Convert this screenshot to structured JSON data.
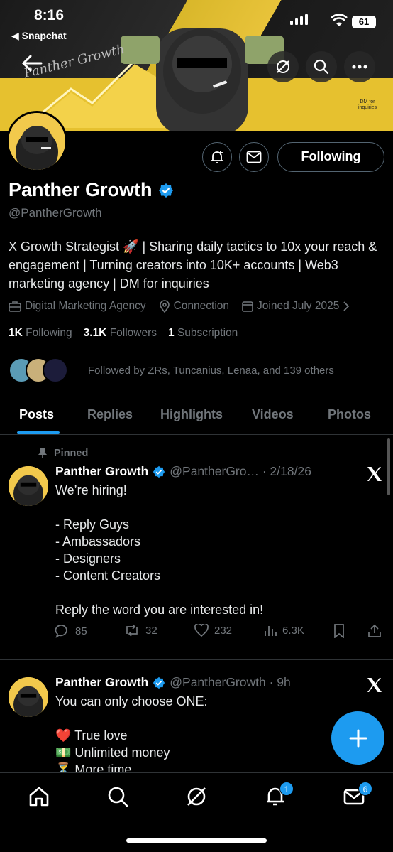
{
  "status_bar": {
    "time": "8:16",
    "back_app": "◀ Snapchat",
    "battery": "61"
  },
  "banner": {
    "text": "Panther Growth",
    "dm_note": "DM for inquiries"
  },
  "profile": {
    "name": "Panther Growth",
    "handle": "@PantherGrowth",
    "follow_label": "Following",
    "bio": "X Growth Strategist 🚀 | Sharing daily tactics to 10x your reach & engagement | Turning creators into 10K+ accounts | Web3 marketing agency | DM for inquiries",
    "category": "Digital Marketing Agency",
    "location": "Connection",
    "joined": "Joined July 2025",
    "following_count": "1K",
    "following_label": "Following",
    "followers_count": "3.1K",
    "followers_label": "Followers",
    "subscription_count": "1",
    "subscription_label": "Subscription",
    "followed_by": "Followed by ZRs, Tuncanius, Lenaa, and 139 others"
  },
  "tabs": [
    "Posts",
    "Replies",
    "Highlights",
    "Videos",
    "Photos"
  ],
  "tweets": [
    {
      "pinned_label": "Pinned",
      "name": "Panther Growth",
      "handle_time": "@PantherGro… · 2/18/26",
      "body": "We’re hiring!\n\n- Reply Guys\n- Ambassadors\n- Designers\n- Content Creators\n\nReply the word you are interested in!",
      "replies": "85",
      "reposts": "32",
      "likes": "232",
      "views": "6.3K"
    },
    {
      "name": "Panther Growth",
      "handle_time": "@PantherGrowth · 9h",
      "body": "You can only choose ONE:\n\n❤️ True love\n💵 Unlimited money\n⏳ More time"
    }
  ],
  "bottom_nav": {
    "notifications_badge": "1",
    "messages_badge": "6"
  },
  "colors": {
    "accent": "#1d9bf0",
    "muted": "#71767b",
    "border": "#2f3336",
    "banner_yellow": "#e6c12f"
  }
}
